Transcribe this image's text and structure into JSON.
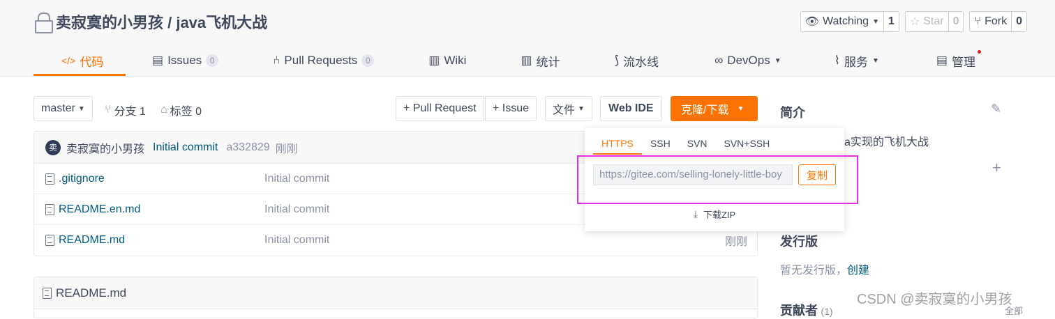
{
  "repo": {
    "title": "卖寂寞的小男孩 / java飞机大战"
  },
  "repo_actions": [
    {
      "label": "Watching",
      "count": "1"
    },
    {
      "label": "Star",
      "count": "0"
    },
    {
      "label": "Fork",
      "count": "0"
    }
  ],
  "tabs": [
    {
      "label": "代码"
    },
    {
      "label": "Issues",
      "badge": "0"
    },
    {
      "label": "Pull Requests",
      "badge": "0"
    },
    {
      "label": "Wiki"
    },
    {
      "label": "统计"
    },
    {
      "label": "流水线"
    },
    {
      "label": "DevOps"
    },
    {
      "label": "服务"
    },
    {
      "label": "管理"
    }
  ],
  "toolbar": {
    "branch": "master",
    "branches": "分支 1",
    "tags": "标签 0",
    "pull_request": "+ Pull Request",
    "issue": "+ Issue",
    "file": "文件",
    "web_ide": "Web IDE",
    "clone": "克隆/下载"
  },
  "commit": {
    "avatar": "卖",
    "author": "卖寂寞的小男孩",
    "message": "Initial commit",
    "hash": "a332829",
    "time": "刚刚"
  },
  "files": [
    {
      "name": ".gitignore",
      "message": "Initial commit",
      "time": ""
    },
    {
      "name": "README.en.md",
      "message": "Initial commit",
      "time": ""
    },
    {
      "name": "README.md",
      "message": "Initial commit",
      "time": "刚刚"
    }
  ],
  "readme": {
    "title": "README.md"
  },
  "clone_popup": {
    "tabs": [
      "HTTPS",
      "SSH",
      "SVN",
      "SVN+SSH"
    ],
    "url": "https://gitee.com/selling-lonely-little-boy",
    "copy": "复制",
    "download_zip": "下载ZIP"
  },
  "sidebar": {
    "intro_title": "简介",
    "intro_text_partial": "a实现的飞机大战",
    "release_title": "发行版",
    "no_release": "暂无发行版，",
    "create": "创建",
    "contributors_title": "贡献者",
    "contributors_count": "(1)",
    "all": "全部"
  },
  "watermark": "CSDN @卖寂寞的小男孩"
}
